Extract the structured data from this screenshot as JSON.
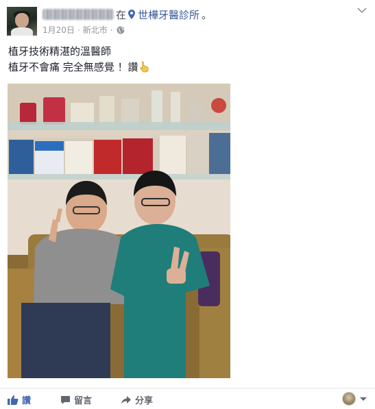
{
  "post": {
    "author_name": "",
    "checkin_prefix": "在",
    "place_name": "世樺牙醫診所",
    "place_suffix": "。",
    "date": "1月20日",
    "location": "新北市",
    "meta_separator": "·",
    "privacy_icon": "globe-icon",
    "options_icon": "chevron-down-icon"
  },
  "text": {
    "line1": "植牙技術精湛的溫醫師",
    "line2_text": "植牙不會痛 完全無感覺 ！讚",
    "line2_emoji": "hand-pointing-icon"
  },
  "photo": {
    "description_icon": "photo-two-men-peace-sign"
  },
  "actions": {
    "like_label": "讚",
    "comment_label": "留言",
    "share_label": "分享",
    "like_icon": "thumbs-up-icon",
    "comment_icon": "comment-icon",
    "share_icon": "share-arrow-icon",
    "like_color": "#4267b2",
    "text_color": "#616770"
  }
}
